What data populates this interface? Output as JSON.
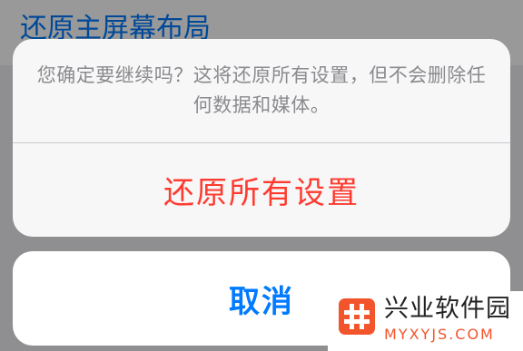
{
  "background": {
    "row_label": "还原主屏幕布局"
  },
  "action_sheet": {
    "message": "您确定要继续吗？这将还原所有设置，但不会删除任何数据和媒体。",
    "destructive_action_label": "还原所有设置",
    "cancel_label": "取消"
  },
  "watermark": {
    "logo_icon": "hash-icon",
    "title": "兴业软件园",
    "url": "MYXYJS.COM"
  },
  "colors": {
    "destructive": "#ff3b30",
    "accent": "#007aff",
    "watermark_brand": "#f2552c"
  }
}
